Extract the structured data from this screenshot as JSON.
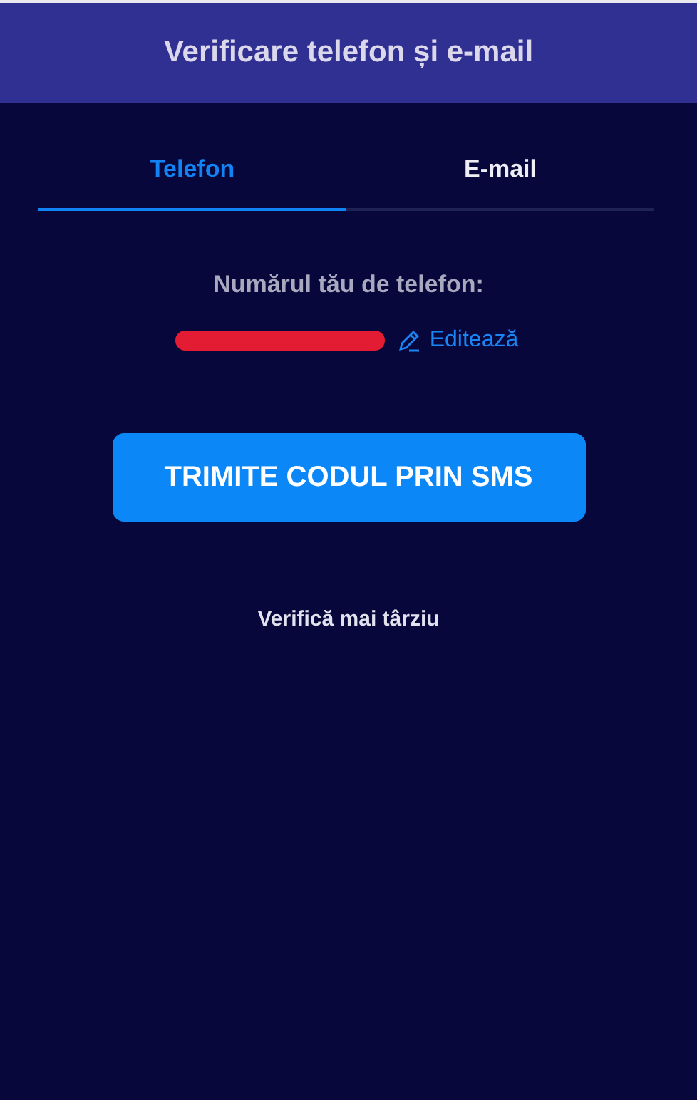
{
  "header": {
    "title": "Verificare telefon și e-mail"
  },
  "tabs": [
    {
      "label": "Telefon",
      "selected": true
    },
    {
      "label": "E-mail",
      "selected": false
    }
  ],
  "phone": {
    "label": "Numărul tău de telefon:",
    "redacted": true,
    "edit_link": "Editează"
  },
  "send_button": "TRIMITE CODUL PRIN SMS",
  "later_link": "Verifică mai târziu"
}
